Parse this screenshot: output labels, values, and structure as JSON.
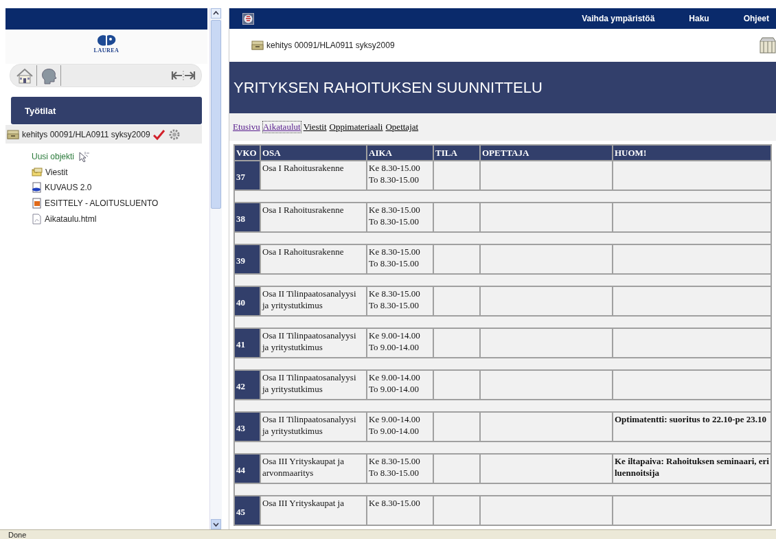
{
  "sidebar": {
    "logo_text": "LAUREA",
    "header": "Työtilat",
    "workspace": {
      "label": "kehitys 00091/HLA0911 syksy2009"
    },
    "items": [
      {
        "kind": "new",
        "label": "Uusi objekti"
      },
      {
        "kind": "messages",
        "label": "Viestit"
      },
      {
        "kind": "document",
        "label": "KUVAUS 2.0"
      },
      {
        "kind": "presentation",
        "label": "ESITTELY - ALOITUSLUENTO"
      },
      {
        "kind": "page",
        "label": "Aikataulu.html"
      }
    ]
  },
  "top_bar": {
    "links": [
      "Vaihda ympäristöä",
      "Haku",
      "Ohjeet"
    ]
  },
  "breadcrumb": "kehitys 00091/HLA0911 syksy2009",
  "title": "YRITYKSEN RAHOITUKSEN SUUNNITTELU",
  "nav": [
    {
      "label": "Etusivu",
      "visited": true,
      "selected": false
    },
    {
      "label": "Aikataulut",
      "visited": true,
      "selected": true
    },
    {
      "label": "Viestit",
      "visited": false,
      "selected": false
    },
    {
      "label": "Oppimateriaali",
      "visited": false,
      "selected": false
    },
    {
      "label": "Opettajat",
      "visited": false,
      "selected": false
    }
  ],
  "table": {
    "columns": [
      "VKO",
      "OSA",
      "AIKA",
      "TILA",
      "OPETTAJA",
      "HUOM!"
    ],
    "rows": [
      {
        "week": "37",
        "part": [
          "Osa I Rahoitusrakenne"
        ],
        "time": [
          "Ke 8.30-15.00",
          "To 8.30-15.00"
        ],
        "note": ""
      },
      {
        "week": "38",
        "part": [
          "Osa I Rahoitusrakenne"
        ],
        "time": [
          "Ke 8.30-15.00",
          "To 8.30-15.00"
        ],
        "note": ""
      },
      {
        "week": "39",
        "part": [
          "Osa I Rahoitusrakenne"
        ],
        "time": [
          "Ke 8.30-15.00",
          "To 8.30-15.00"
        ],
        "note": ""
      },
      {
        "week": "40",
        "part": [
          "Osa II Tilinpaatosanalyysi",
          "ja yritystutkimus"
        ],
        "time": [
          "Ke 8.30-15.00",
          "To 8.30-15.00"
        ],
        "note": ""
      },
      {
        "week": "41",
        "part": [
          "Osa II Tilinpaatosanalyysi",
          "ja yritystutkimus"
        ],
        "time": [
          "Ke 9.00-14.00",
          "To 9.00-14.00"
        ],
        "note": ""
      },
      {
        "week": "42",
        "part": [
          "Osa II Tilinpaatosanalyysi",
          "ja yritystutkimus"
        ],
        "time": [
          "Ke 9.00-14.00",
          "To 9.00-14.00"
        ],
        "note": ""
      },
      {
        "week": "43",
        "part": [
          "Osa II Tilinpaatosanalyysi",
          "ja yritystutkimus"
        ],
        "time": [
          "Ke 9.00-14.00",
          "To 9.00-14.00"
        ],
        "note": "Optimatentti: suoritus to 22.10-pe 23.10"
      },
      {
        "week": "44",
        "part": [
          "Osa III Yrityskaupat ja",
          "arvonmaaritys"
        ],
        "time": [
          "Ke 8.30-15.00",
          "To 8.30-15.00"
        ],
        "note": "Ke iltapaiva: Rahoituksen seminaari, eri luennoitsija"
      },
      {
        "week": "45",
        "part": [
          "Osa III Yrityskaupat ja"
        ],
        "time": [
          "Ke 8.30-15.00"
        ],
        "note": ""
      }
    ]
  },
  "status_bar": "Done"
}
